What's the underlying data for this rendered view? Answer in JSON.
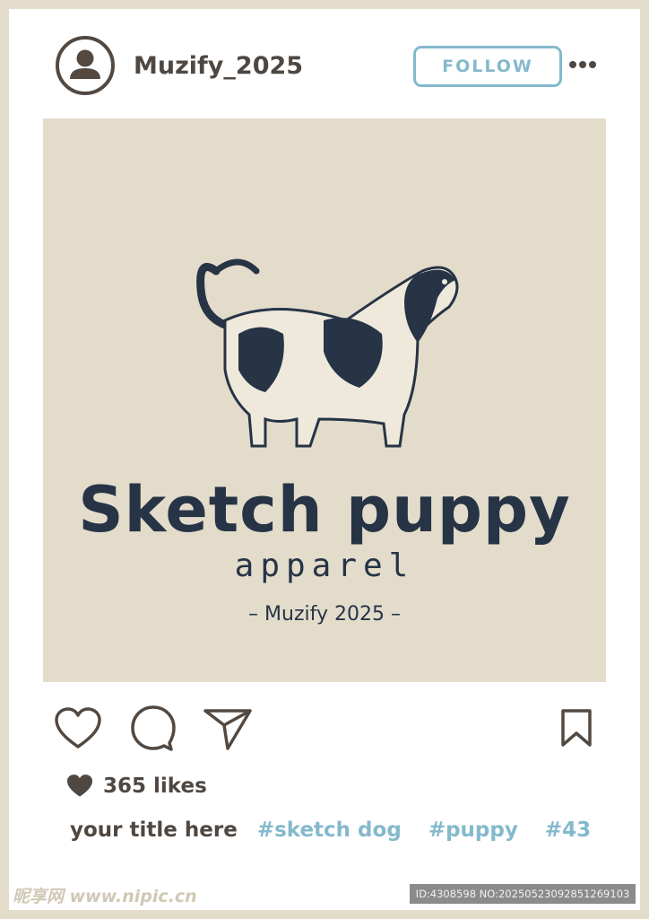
{
  "post": {
    "username": "Muzify_2025",
    "follow_label": "FOLLOW",
    "image": {
      "brand_title": "Sketch puppy",
      "brand_subtitle": "apparel",
      "brand_tagline": "– Muzify 2025 –"
    },
    "likes_text": "365 likes",
    "caption_title": "your title here",
    "hashtags": [
      "#sketch dog",
      "#puppy",
      "#43"
    ]
  },
  "actions": {
    "like_icon": "heart-outline-icon",
    "comment_icon": "speech-bubble-icon",
    "share_icon": "paper-plane-icon",
    "save_icon": "bookmark-icon",
    "more_icon": "three-dots-icon"
  },
  "colors": {
    "frame": "#e3dccb",
    "text_dark": "#4f4741",
    "accent": "#84b9cc",
    "ink": "#273446"
  },
  "watermark": {
    "site": "昵享网 www.nipic.cn",
    "id_text": "ID:4308598 NO:20250523092851269103"
  }
}
